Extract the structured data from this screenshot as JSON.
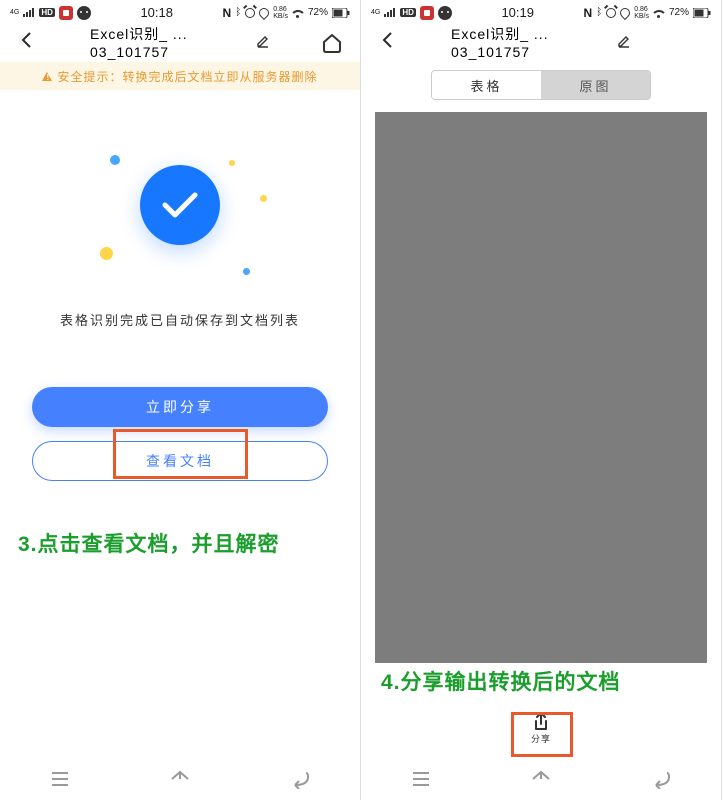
{
  "status": {
    "left": {
      "sig_label": "4G",
      "hd_badge": "HD"
    },
    "left_time": "10:18",
    "right_time": "10:19",
    "battery": "72%",
    "speed_top": "0.86",
    "speed_btm": "KB/s",
    "bt": "ᛒ",
    "nfc_label": "N"
  },
  "header": {
    "title": "Excel识别_ ... 03_101757",
    "back_aria": "back",
    "edit_aria": "edit",
    "home_aria": "home"
  },
  "banner": {
    "text": "安全提示：转换完成后文档立即从服务器删除"
  },
  "success": {
    "message": "表格识别完成已自动保存到文档列表"
  },
  "buttons": {
    "share_now": "立即分享",
    "view_doc": "查看文档"
  },
  "annotations": {
    "step3": "3.点击查看文档，并且解密",
    "step4": "4.分享输出转换后的文档"
  },
  "tabs": {
    "table": "表格",
    "original": "原图"
  },
  "bottom": {
    "share_label": "分享"
  },
  "nav": {
    "menu_aria": "menu",
    "home_aria": "home",
    "back_aria": "back"
  }
}
